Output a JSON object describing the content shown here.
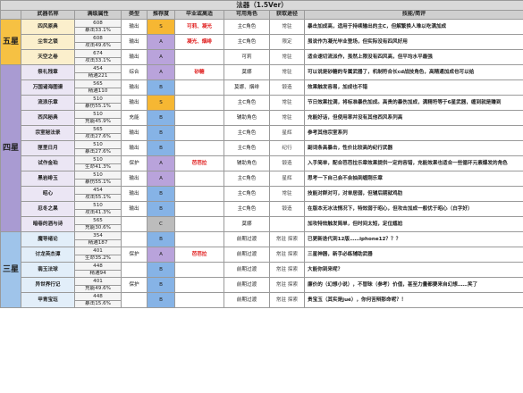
{
  "title": "法器（1.5Ver）",
  "headers": [
    "武器名称",
    "满级属性",
    "类型",
    "推荐度",
    "毕业或高适",
    "可用角色",
    "获取途径",
    "技能/简评"
  ],
  "groups": [
    {
      "star": "五星",
      "cls": "5",
      "rows": [
        {
          "name": "四风原典",
          "atk": "608",
          "sub": "暴击33.1%",
          "type": "输出",
          "rank": "S",
          "best": "可莉、凝光",
          "best_red": true,
          "chars": "主C角色",
          "src": "常驻",
          "review": "暴击加成高，适用于持续输出的主C，但解繁换人难以吃满加成"
        },
        {
          "name": "尘世之锁",
          "atk": "608",
          "sub": "攻击49.6%",
          "type": "输出",
          "rank": "A",
          "best": "凝光、烟绯",
          "best_red": true,
          "chars": "主C角色",
          "src": "限定",
          "review": "虽说作为凝光毕业登场，但实际没有四风好用"
        },
        {
          "name": "天空之卷",
          "atk": "674",
          "sub": "攻击33.1%",
          "type": "输出",
          "rank": "A",
          "best": "",
          "best_red": false,
          "chars": "可莉",
          "src": "常驻",
          "review": "适合速切流派作，虽然上限没有四风高，但平均水平最强"
        }
      ]
    },
    {
      "star": "四星",
      "cls": "4",
      "rows": [
        {
          "name": "祭礼残章",
          "atk": "454",
          "sub": "精通221",
          "type": "综合",
          "rank": "A",
          "best": "砂糖",
          "best_red": true,
          "chars": "莫娜",
          "src": "常驻",
          "review": "可以说是砂糖的专属武器了，机制符合长cd战技角色，高精通加成也可以给"
        },
        {
          "name": "万国诸海图谱",
          "atk": "565",
          "sub": "精通110",
          "type": "输出",
          "rank": "B",
          "best": "",
          "best_red": false,
          "chars": "莫娜、烟绯",
          "src": "锻造",
          "review": "效果触发容易，加成也不错"
        },
        {
          "name": "流浪乐章",
          "atk": "510",
          "sub": "暴伤55.1%",
          "type": "输出",
          "rank": "S",
          "best": "",
          "best_red": false,
          "chars": "主C角色",
          "src": "常驻",
          "review": "节日效果拉满，将标准暴伤加成。高贵的暴伤加成，满精符等于6星武器，缠到就是赚到"
        },
        {
          "name": "西风秘典",
          "atk": "510",
          "sub": "充能45.9%",
          "type": "充能",
          "rank": "B",
          "best": "",
          "best_red": false,
          "chars": "辅助角色",
          "src": "常驻",
          "review": "充能好话，但使用率并没有其他西风系列高"
        },
        {
          "name": "宗室秘法录",
          "atk": "565",
          "sub": "攻击27.6%",
          "type": "输出",
          "rank": "B",
          "best": "",
          "best_red": false,
          "chars": "主C角色",
          "src": "星辉",
          "review": "参考其他宗室系列"
        },
        {
          "name": "匣里日月",
          "atk": "510",
          "sub": "暴击27.6%",
          "type": "输出",
          "rank": "B",
          "best": "",
          "best_red": false,
          "chars": "主C角色",
          "src": "纪行",
          "review": "副词条高暴击，性价比较高的纪行武器"
        },
        {
          "name": "试作金珀",
          "atk": "510",
          "sub": "生命41.3%",
          "type": "保护",
          "rank": "A",
          "best": "芭芭拉",
          "best_red": true,
          "chars": "辅助角色",
          "src": "锻造",
          "review": "入手简单，配合芭芭拉乐章效果提供一定的容错，充能效果也适合一些循环元素爆发的角色"
        },
        {
          "name": "黑岩绯玉",
          "atk": "510",
          "sub": "暴伤55.1%",
          "type": "输出",
          "rank": "A",
          "best": "",
          "best_red": false,
          "chars": "主C角色",
          "src": "星辉",
          "review": "思考一下自己会不会抽到缠刚乐章"
        },
        {
          "name": "昭心",
          "atk": "454",
          "sub": "攻击55.1%",
          "type": "输出",
          "rank": "B",
          "best": "",
          "best_red": false,
          "chars": "主C角色",
          "src": "常驻",
          "review": "技能对群对可，对单居弱，但辅后期就鸡肋"
        },
        {
          "name": "忍冬之果",
          "atk": "510",
          "sub": "攻击41.3%",
          "type": "输出",
          "rank": "B",
          "best": "",
          "best_red": false,
          "chars": "主C角色",
          "src": "锻造",
          "review": "在版本无冰法情况下，特效弱于昭心，但攻击加成一般优于昭心（白字好）"
        },
        {
          "name": "暗巷的酒与诗",
          "atk": "565",
          "sub": "充能30.6%",
          "type": "",
          "rank": "C",
          "best": "",
          "best_red": false,
          "chars": "莫娜",
          "src": "",
          "review": "加攻特效触发简单，但时间太短，定位尴尬"
        }
      ]
    },
    {
      "star": "三星",
      "cls": "3",
      "rows": [
        {
          "name": "魔导绪论",
          "atk": "354",
          "sub": "精通187",
          "type": "",
          "rank": "B",
          "best": "",
          "best_red": false,
          "chars": "前期过渡",
          "src": "常驻 探索",
          "review": "已更新迭代到12版……iphone12？？？"
        },
        {
          "name": "讨龙英杰谭",
          "atk": "401",
          "sub": "生命35.2%",
          "type": "保护",
          "rank": "A",
          "best": "芭芭拉",
          "best_red": true,
          "chars": "前期过渡",
          "src": "常驻 探索",
          "review": "三星神器，新手必练辅助武器"
        },
        {
          "name": "翡玉法球",
          "atk": "448",
          "sub": "精通94",
          "type": "",
          "rank": "B",
          "best": "",
          "best_red": false,
          "chars": "前期过渡",
          "src": "常驻 探索",
          "review": "大能你到来呢？"
        },
        {
          "name": "异世界行记",
          "atk": "401",
          "sub": "充能49.6%",
          "type": "保护",
          "rank": "B",
          "best": "",
          "best_red": false,
          "chars": "前期过渡",
          "src": "常驻 探索",
          "review": "廉价的（幻想小说），不冒昧（参考）价值，甚至力量都要来自幻想……笑了"
        },
        {
          "name": "甲胄宝珏",
          "atk": "448",
          "sub": "暴击15.6%",
          "type": "",
          "rank": "B",
          "best": "",
          "best_red": false,
          "chars": "前期过渡",
          "src": "常驻 探索",
          "review": "贵宝玉（其实是jué），你何苦辩那命呢？！"
        }
      ]
    }
  ],
  "colors": {
    "rank_S": "#f6b733",
    "rank_A": "#b9a3db",
    "rank_B": "#86b3e6",
    "rank_C": "#bcbcbc",
    "highlight": "#e02020"
  }
}
